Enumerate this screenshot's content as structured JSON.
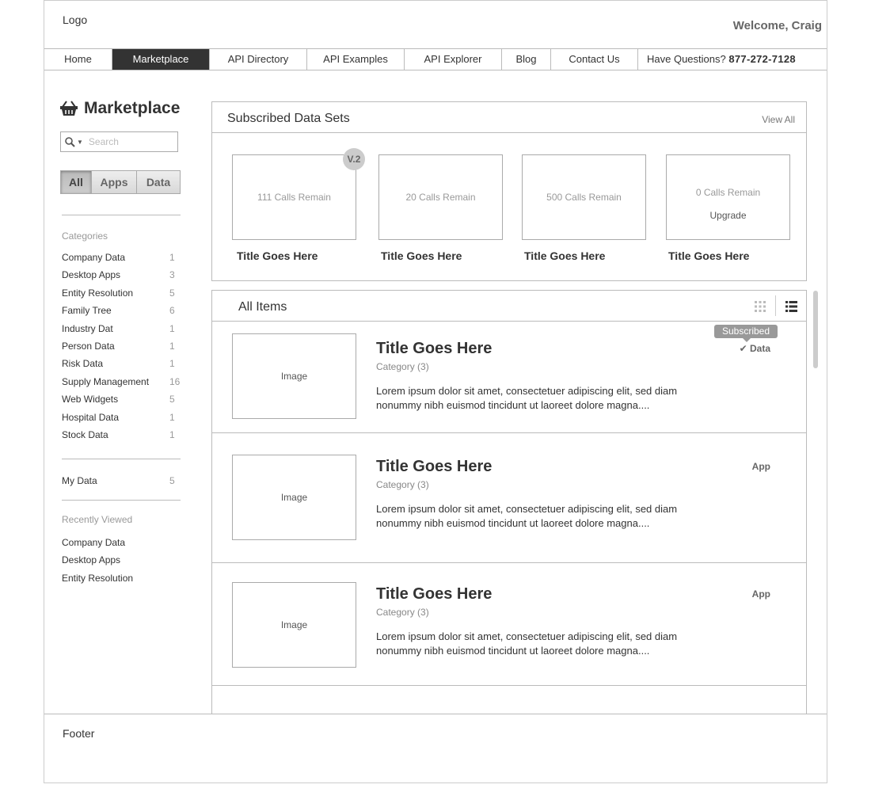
{
  "header": {
    "logo": "Logo",
    "welcome": "Welcome, Craig"
  },
  "nav": {
    "items": [
      "Home",
      "Marketplace",
      "API Directory",
      "API Examples",
      "API Explorer",
      "Blog",
      "Contact Us"
    ],
    "active": "Marketplace",
    "phone_label": "Have Questions?",
    "phone_number": "877-272-7128"
  },
  "sidebar": {
    "title": "Marketplace",
    "search_placeholder": "Search",
    "filters": [
      "All",
      "Apps",
      "Data"
    ],
    "selected_filter": "All",
    "categories_heading": "Categories",
    "categories": [
      {
        "label": "Company Data",
        "count": "1"
      },
      {
        "label": "Desktop Apps",
        "count": "3"
      },
      {
        "label": "Entity Resolution",
        "count": "5"
      },
      {
        "label": "Family Tree",
        "count": "6"
      },
      {
        "label": "Industry Dat",
        "count": "1"
      },
      {
        "label": "Person Data",
        "count": "1"
      },
      {
        "label": "Risk Data",
        "count": "1"
      },
      {
        "label": "Supply Management",
        "count": "16"
      },
      {
        "label": "Web Widgets",
        "count": "5"
      },
      {
        "label": "Hospital Data",
        "count": "1"
      },
      {
        "label": "Stock Data",
        "count": "1"
      }
    ],
    "my_data": {
      "label": "My Data",
      "count": "5"
    },
    "recent_heading": "Recently Viewed",
    "recent": [
      "Company Data",
      "Desktop Apps",
      "Entity Resolution"
    ]
  },
  "subscribed": {
    "title": "Subscribed Data Sets",
    "view_all": "View All",
    "version_badge": "V.2",
    "cards": [
      {
        "calls": "111 Calls Remain",
        "title": "Title Goes Here"
      },
      {
        "calls": "20 Calls Remain",
        "title": "Title Goes Here"
      },
      {
        "calls": "500 Calls Remain",
        "title": "Title Goes Here"
      },
      {
        "calls": "0 Calls Remain",
        "upgrade": "Upgrade",
        "title": "Title Goes Here"
      }
    ]
  },
  "all_items": {
    "title": "All Items",
    "items": [
      {
        "image": "Image",
        "title": "Title Goes Here",
        "category": "Category (3)",
        "desc1": "Lorem ipsum dolor sit amet, consectetuer adipiscing elit, sed diam",
        "desc2": "nonummy nibh euismod tincidunt ut laoreet dolore magna....",
        "type": "Data",
        "badge": "Subscribed"
      },
      {
        "image": "Image",
        "title": "Title Goes Here",
        "category": "Category (3)",
        "desc1": "Lorem ipsum dolor sit amet, consectetuer adipiscing elit, sed diam",
        "desc2": "nonummy nibh euismod tincidunt ut laoreet dolore magna....",
        "type": "App"
      },
      {
        "image": "Image",
        "title": "Title Goes Here",
        "category": "Category (3)",
        "desc1": "Lorem ipsum dolor sit amet, consectetuer adipiscing elit, sed diam",
        "desc2": "nonummy nibh euismod tincidunt ut laoreet dolore magna....",
        "type": "App"
      }
    ]
  },
  "footer": {
    "label": "Footer"
  }
}
